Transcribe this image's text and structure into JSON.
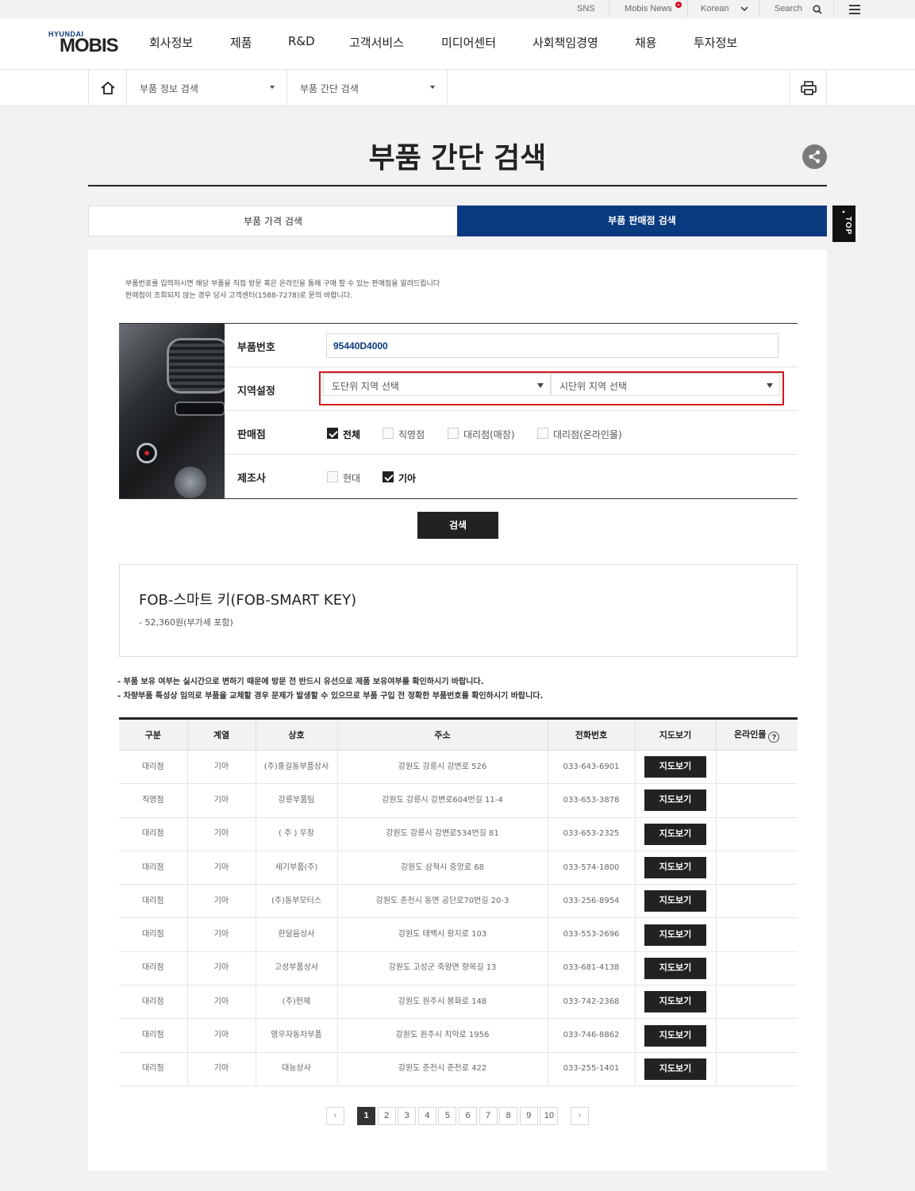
{
  "util": {
    "sns": "SNS",
    "news": "Mobis News",
    "lang": "Korean",
    "search": "Search"
  },
  "logo": {
    "top": "HYUNDAI",
    "bottom": "MOBIS"
  },
  "gnb": [
    "회사정보",
    "제품",
    "R&D",
    "고객서비스",
    "미디어센터",
    "사회책임경영",
    "채용",
    "투자정보"
  ],
  "location": {
    "level1": "부품 정보 검색",
    "level2": "부품 간단 검색"
  },
  "page_title": "부품 간단 검색",
  "tabs": {
    "price_search": "부품 가격 검색",
    "dealer_search": "부품 판매점 검색"
  },
  "top_button": "TOP",
  "description": {
    "line1": "부품번호를 입력하시면 해당 부품을 직접 방문 혹은 온라인을 통해 구매 할 수 있는 판매점을 알려드립니다",
    "line2": "판매점이 조회되지 않는 경우 당사 고객센터(1588-7278)로 문의 바랍니다."
  },
  "form": {
    "part_no_label": "부품번호",
    "part_no_value": "95440D4000",
    "region_label": "지역설정",
    "province_placeholder": "도단위 지역 선택",
    "city_placeholder": "시단위 지역 선택",
    "dealer_label": "판매점",
    "dealer_options": [
      {
        "label": "전체",
        "checked": true
      },
      {
        "label": "직영점",
        "checked": false
      },
      {
        "label": "대리점(매장)",
        "checked": false
      },
      {
        "label": "대리점(온라인몰)",
        "checked": false
      }
    ],
    "maker_label": "제조사",
    "maker_options": [
      {
        "label": "현대",
        "checked": false
      },
      {
        "label": "기아",
        "checked": true
      }
    ],
    "search_button": "검색"
  },
  "part": {
    "name": "FOB-스마트 키(FOB-SMART KEY)",
    "price": "- 52,360원(부가세 포함)"
  },
  "notices": [
    "- 부품 보유 여부는 실시간으로 변하기 때문에 방문 전 반드시 유선으로 제품 보유여부를 확인하시기 바랍니다.",
    "- 차량부품 특성상 임의로 부품을 교체할 경우 문제가 발생할 수 있으므로 부품 구입 전 정확한 부품번호를 확인하시기 바랍니다."
  ],
  "table": {
    "headers": [
      "구분",
      "계열",
      "상호",
      "주소",
      "전화번호",
      "지도보기",
      "온라인몰"
    ],
    "map_button": "지도보기",
    "rows": [
      [
        "대리점",
        "기아",
        "(주)홍길동부품상사",
        "강원도 강릉시 강변로 526",
        "033-643-6901"
      ],
      [
        "직영점",
        "기아",
        "강릉부품팀",
        "강원도 강릉시 강변로604번길 11-4",
        "033-653-3878"
      ],
      [
        "대리점",
        "기아",
        "( 주 ) 우창",
        "강원도 강릉시 강변로534번길 81",
        "033-653-2325"
      ],
      [
        "대리점",
        "기아",
        "세기부품(주)",
        "강원도 삼척시 중앙로 68",
        "033-574-1800"
      ],
      [
        "대리점",
        "기아",
        "(주)동부모터스",
        "강원도 춘천시 동면 공단로70번길 20-3",
        "033-256-8954"
      ],
      [
        "대리점",
        "기아",
        "한달음상사",
        "강원도 태백시 황지로 103",
        "033-553-2696"
      ],
      [
        "대리점",
        "기아",
        "고성부품상사",
        "강원도 고성군 죽왕면 향목길 13",
        "033-681-4138"
      ],
      [
        "대리점",
        "기아",
        "(주)현제",
        "강원도 원주시 봉화로 148",
        "033-742-2368"
      ],
      [
        "대리점",
        "기아",
        "영우자동차부품",
        "강원도 원주시 치악로 1956",
        "033-746-8862"
      ],
      [
        "대리점",
        "기아",
        "대능상사",
        "강원도 춘천시 춘천로 422",
        "033-255-1401"
      ]
    ]
  },
  "pagination": {
    "prev": "‹",
    "next": "›",
    "pages": [
      "1",
      "2",
      "3",
      "4",
      "5",
      "6",
      "7",
      "8",
      "9",
      "10"
    ],
    "current": "1"
  }
}
